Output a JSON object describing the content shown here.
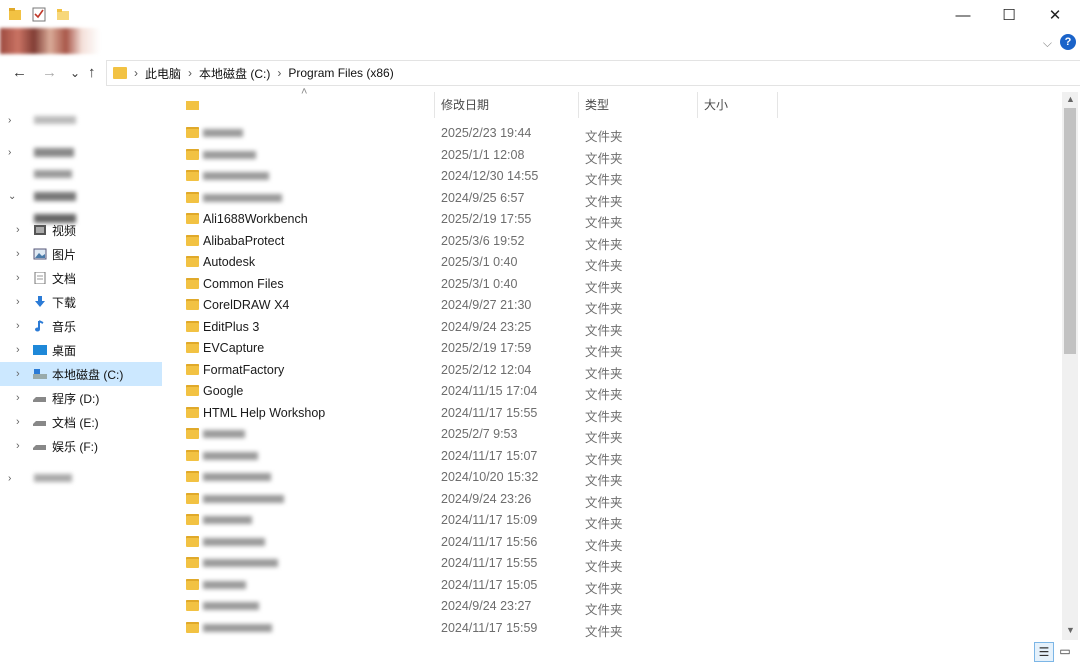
{
  "window": {
    "minimize_label": "—",
    "maximize_label": "☐",
    "close_label": "✕",
    "help_label": "?",
    "ribbon_expand_label": "⌵"
  },
  "nav": {
    "back_label": "←",
    "forward_label": "→",
    "recent_label": "⌄",
    "up_label": "↑"
  },
  "address": {
    "crumbs": [
      "此电脑",
      "本地磁盘 (C:)",
      "Program Files (x86)"
    ],
    "separator": "›"
  },
  "sidebar": {
    "items": [
      {
        "label": "",
        "icon": "quick-access-icon"
      },
      {
        "label": "",
        "icon": "onedrive-icon"
      },
      {
        "label": "",
        "icon": "this-pc-icon"
      },
      {
        "label": "",
        "icon": "3d-objects-icon"
      },
      {
        "label": "视频",
        "icon": "video-icon"
      },
      {
        "label": "图片",
        "icon": "pictures-icon"
      },
      {
        "label": "文档",
        "icon": "documents-icon"
      },
      {
        "label": "下载",
        "icon": "download-icon"
      },
      {
        "label": "音乐",
        "icon": "music-icon"
      },
      {
        "label": "桌面",
        "icon": "desktop-icon"
      },
      {
        "label": "本地磁盘 (C:)",
        "icon": "drive-c-icon"
      },
      {
        "label": "程序 (D:)",
        "icon": "drive-icon"
      },
      {
        "label": "文档 (E:)",
        "icon": "drive-icon"
      },
      {
        "label": "娱乐 (F:)",
        "icon": "drive-icon"
      },
      {
        "label": "",
        "icon": "network-icon"
      }
    ]
  },
  "columns": {
    "name": "",
    "date": "修改日期",
    "type": "类型",
    "size": "大小",
    "sort_indicator": "˄"
  },
  "files": [
    {
      "name": "",
      "date": "2025/2/23 19:44",
      "type": "文件夹",
      "blurred": true
    },
    {
      "name": "",
      "date": "2025/1/1 12:08",
      "type": "文件夹",
      "blurred": true
    },
    {
      "name": "",
      "date": "2024/12/30 14:55",
      "type": "文件夹",
      "blurred": true
    },
    {
      "name": "",
      "date": "2024/9/25 6:57",
      "type": "文件夹",
      "blurred": true
    },
    {
      "name": "Ali1688Workbench",
      "date": "2025/2/19 17:55",
      "type": "文件夹",
      "blurred": false
    },
    {
      "name": "AlibabaProtect",
      "date": "2025/3/6 19:52",
      "type": "文件夹",
      "blurred": false
    },
    {
      "name": "Autodesk",
      "date": "2025/3/1 0:40",
      "type": "文件夹",
      "blurred": false
    },
    {
      "name": "Common Files",
      "date": "2025/3/1 0:40",
      "type": "文件夹",
      "blurred": false
    },
    {
      "name": "CorelDRAW X4",
      "date": "2024/9/27 21:30",
      "type": "文件夹",
      "blurred": false
    },
    {
      "name": "EditPlus 3",
      "date": "2024/9/24 23:25",
      "type": "文件夹",
      "blurred": false
    },
    {
      "name": "EVCapture",
      "date": "2025/2/19 17:59",
      "type": "文件夹",
      "blurred": false
    },
    {
      "name": "FormatFactory",
      "date": "2025/2/12 12:04",
      "type": "文件夹",
      "blurred": false
    },
    {
      "name": "Google",
      "date": "2024/11/15 17:04",
      "type": "文件夹",
      "blurred": false
    },
    {
      "name": "HTML Help Workshop",
      "date": "2024/11/17 15:55",
      "type": "文件夹",
      "blurred": false
    },
    {
      "name": "",
      "date": "2025/2/7 9:53",
      "type": "文件夹",
      "blurred": true
    },
    {
      "name": "",
      "date": "2024/11/17 15:07",
      "type": "文件夹",
      "blurred": true
    },
    {
      "name": "",
      "date": "2024/10/20 15:32",
      "type": "文件夹",
      "blurred": true
    },
    {
      "name": "",
      "date": "2024/9/24 23:26",
      "type": "文件夹",
      "blurred": true
    },
    {
      "name": "",
      "date": "2024/11/17 15:09",
      "type": "文件夹",
      "blurred": true
    },
    {
      "name": "",
      "date": "2024/11/17 15:56",
      "type": "文件夹",
      "blurred": true
    },
    {
      "name": "",
      "date": "2024/11/17 15:55",
      "type": "文件夹",
      "blurred": true
    },
    {
      "name": "",
      "date": "2024/11/17 15:05",
      "type": "文件夹",
      "blurred": true
    },
    {
      "name": "",
      "date": "2024/9/24 23:27",
      "type": "文件夹",
      "blurred": true
    },
    {
      "name": "",
      "date": "2024/11/17 15:59",
      "type": "文件夹",
      "blurred": true
    }
  ],
  "status": {
    "details_view_label": "☰",
    "large_icons_view_label": "▭"
  },
  "colors": {
    "folder": "#f2c243",
    "selection": "#cce8ff",
    "help": "#1a63c9"
  }
}
